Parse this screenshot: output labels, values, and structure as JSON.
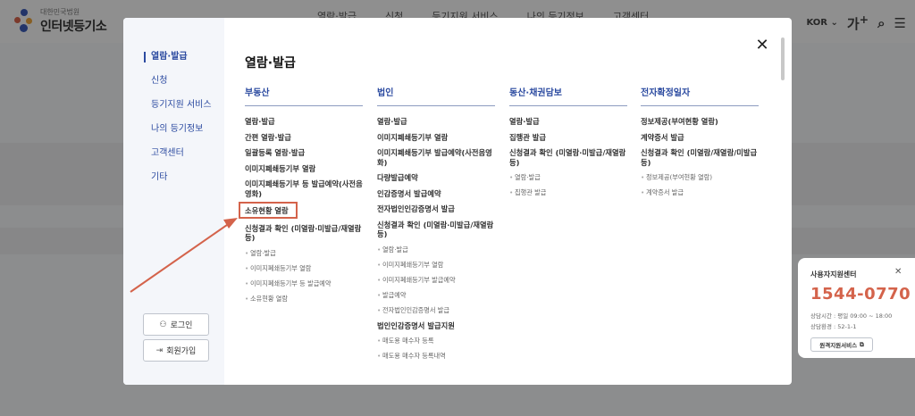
{
  "header": {
    "logo_sub": "대한민국법원",
    "logo_main": "인터넷등기소",
    "nav": [
      "열람·발급",
      "신청",
      "등기지원 서비스",
      "나의 등기정보",
      "고객센터"
    ],
    "lang": "KOR",
    "font_size": "가",
    "font_size_mark": "+"
  },
  "modal": {
    "title": "열람·발급",
    "close_label": "✕",
    "side_menu": [
      "열람·발급",
      "신청",
      "등기지원 서비스",
      "나의 등기정보",
      "고객센터",
      "기타"
    ],
    "login_label": "로그인",
    "signup_label": "회원가입",
    "columns": [
      {
        "header": "부동산",
        "links": [
          "열람·발급",
          "간편 열람·발급",
          "일괄등록 열람·발급",
          "이미지폐쇄등기부 열람",
          "이미지폐쇄등기부 등 발급예약(사전음영화)",
          "소유현황 열람",
          "신청결과 확인 (미열람·미발급/재열람 등)"
        ],
        "sublinks": [
          "열람·발급",
          "이미지폐쇄등기부 열람",
          "이미지폐쇄등기부 등 발급예약",
          "소유현황 열람"
        ]
      },
      {
        "header": "법인",
        "links": [
          "열람·발급",
          "이미지폐쇄등기부 열람",
          "이미지폐쇄등기부 발급예약(사전음영화)",
          "다량발급예약",
          "인감증명서 발급예약",
          "전자법인인감증명서 발급",
          "신청결과 확인 (미열람·미발급/재열람 등)"
        ],
        "sublinks": [
          "열람·발급",
          "이미지폐쇄등기부 열람",
          "이미지폐쇄등기부 발급예약",
          "발급예약",
          "전자법인인감증명서 발급"
        ],
        "links2": [
          "법인인감증명서 발급지원"
        ],
        "sublinks2": [
          "매도용 매수자 등록",
          "매도용 매수자 등록내역"
        ]
      },
      {
        "header": "동산·채권담보",
        "links": [
          "열람·발급",
          "집행관 발급",
          "신청결과 확인 (미열람·미발급/재열람 등)"
        ],
        "sublinks": [
          "열람·발급",
          "집행관 발급"
        ]
      },
      {
        "header": "전자확정일자",
        "links": [
          "정보제공(부여현황 열람)",
          "계약증서 발급",
          "신청결과 확인 (미열람/재열람/미발급 등)"
        ],
        "sublinks": [
          "정보제공(부여현황 열람)",
          "계약증서 발급"
        ]
      }
    ]
  },
  "help_card": {
    "title": "사용자지원센터",
    "close_label": "✕",
    "phone": "1544-0770",
    "hours": "상담시간 : 평일 09:00 ~ 18:00",
    "option": "상담환경 : 52-1-1",
    "button_label": "원격지원서비스"
  },
  "colors": {
    "accent_blue": "#2b4aa0",
    "highlight_red": "#d4634b"
  }
}
